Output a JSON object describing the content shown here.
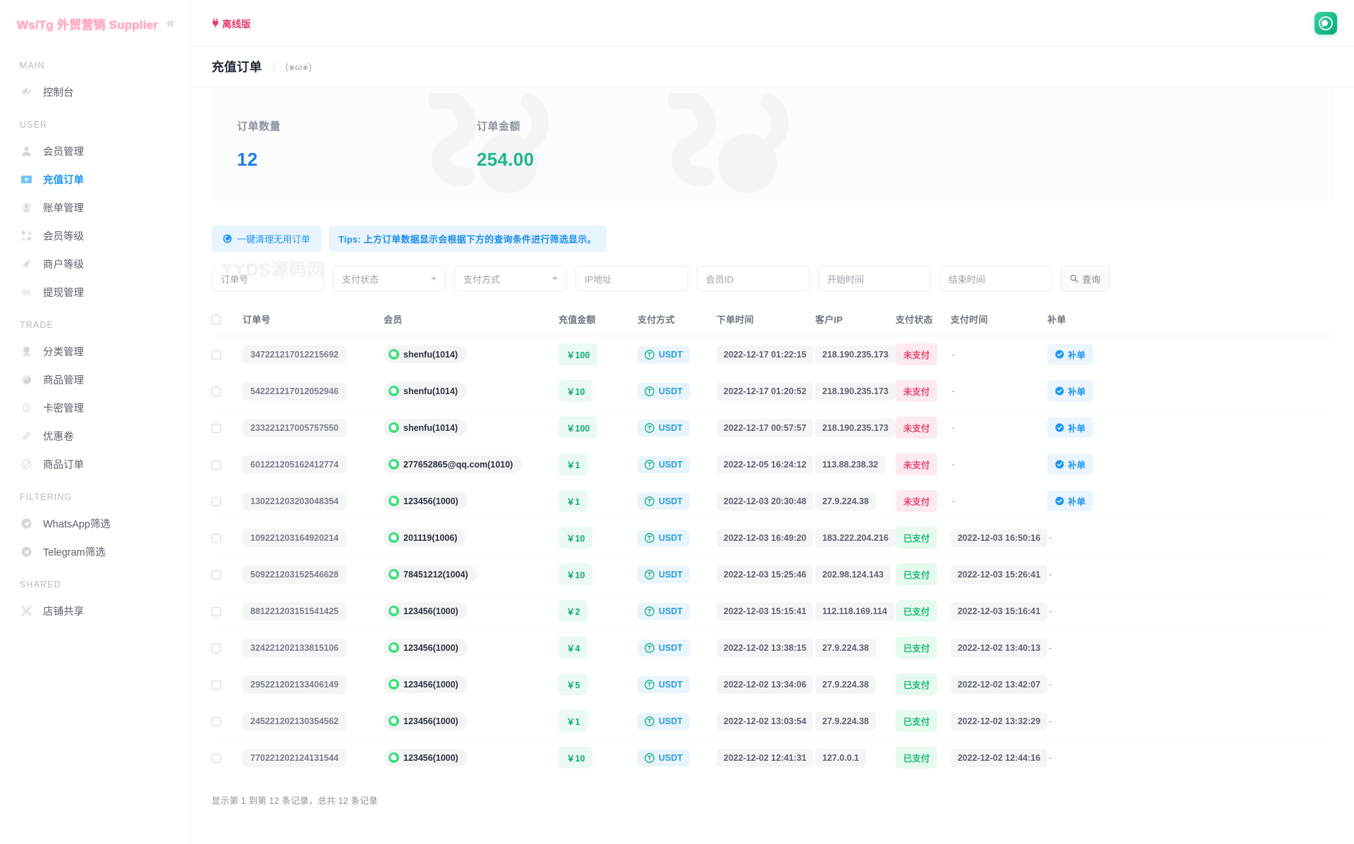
{
  "sidebar": {
    "brand": "Ws/Tg 外贸营销 Supplier",
    "collapse_icon": "chevron-double-left-icon",
    "sections": [
      {
        "label": "MAIN",
        "items": [
          {
            "label": "控制台",
            "icon": "dashboard-icon",
            "active": false
          }
        ]
      },
      {
        "label": "USER",
        "items": [
          {
            "label": "会员管理",
            "icon": "user-icon",
            "active": false
          },
          {
            "label": "充值订单",
            "icon": "recharge-icon",
            "active": true
          },
          {
            "label": "账单管理",
            "icon": "bill-icon",
            "active": false
          },
          {
            "label": "会员等级",
            "icon": "level-icon",
            "active": false
          },
          {
            "label": "商户等级",
            "icon": "merchant-icon",
            "active": false
          },
          {
            "label": "提现管理",
            "icon": "withdraw-icon",
            "active": false
          }
        ]
      },
      {
        "label": "TRADE",
        "items": [
          {
            "label": "分类管理",
            "icon": "category-icon",
            "active": false
          },
          {
            "label": "商品管理",
            "icon": "product-icon",
            "active": false
          },
          {
            "label": "卡密管理",
            "icon": "card-icon",
            "active": false
          },
          {
            "label": "优惠卷",
            "icon": "coupon-icon",
            "active": false
          },
          {
            "label": "商品订单",
            "icon": "order-icon",
            "active": false
          }
        ]
      },
      {
        "label": "FILTERING",
        "items": [
          {
            "label": "WhatsApp筛选",
            "icon": "telegram-icon",
            "active": false
          },
          {
            "label": "Telegram筛选",
            "icon": "telegram-icon",
            "active": false
          }
        ]
      },
      {
        "label": "SHARED",
        "items": [
          {
            "label": "店铺共享",
            "icon": "share-icon",
            "active": false
          }
        ]
      }
    ]
  },
  "topbar": {
    "offline_label": "离线版",
    "offline_icon": "plug-icon",
    "avatar_icon": "avatar-icon"
  },
  "page": {
    "title": "充值订单",
    "subtitle": "(๑ω๑)"
  },
  "stats": [
    {
      "label": "订单数量",
      "value": "12",
      "color": "#1f7fe0"
    },
    {
      "label": "订单金额",
      "value": "254.00",
      "color": "#1db887"
    }
  ],
  "toolbar": {
    "clean_label": "一键清理无用订单",
    "clean_icon": "clean-icon",
    "tips": "Tips: 上方订单数据显示会根据下方的查询条件进行筛选显示。"
  },
  "watermark": "YYDS源码网",
  "filters": {
    "order_no_placeholder": "订单号",
    "pay_status_placeholder": "支付状态",
    "pay_method_placeholder": "支付方式",
    "ip_placeholder": "IP地址",
    "member_id_placeholder": "会员ID",
    "start_time_placeholder": "开始时间",
    "end_time_placeholder": "结束时间",
    "search_label": "查询",
    "search_icon": "search-icon"
  },
  "table": {
    "headers": [
      "",
      "订单号",
      "会员",
      "充值金额",
      "支付方式",
      "下单时间",
      "客户IP",
      "支付状态",
      "支付时间",
      "补单"
    ],
    "supplement_label": "补单",
    "rows": [
      {
        "order_no": "347221217012215692",
        "member": "shenfu(1014)",
        "amount": "￥100",
        "method": "USDT",
        "order_time": "2022-12-17 01:22:15",
        "ip": "218.190.235.173",
        "status": "未支付",
        "paid": false,
        "pay_time": "-",
        "supplement": true
      },
      {
        "order_no": "542221217012052946",
        "member": "shenfu(1014)",
        "amount": "￥10",
        "method": "USDT",
        "order_time": "2022-12-17 01:20:52",
        "ip": "218.190.235.173",
        "status": "未支付",
        "paid": false,
        "pay_time": "-",
        "supplement": true
      },
      {
        "order_no": "233221217005757550",
        "member": "shenfu(1014)",
        "amount": "￥100",
        "method": "USDT",
        "order_time": "2022-12-17 00:57:57",
        "ip": "218.190.235.173",
        "status": "未支付",
        "paid": false,
        "pay_time": "-",
        "supplement": true
      },
      {
        "order_no": "601221205162412774",
        "member": "277652865@qq.com(1010)",
        "amount": "￥1",
        "method": "USDT",
        "order_time": "2022-12-05 16:24:12",
        "ip": "113.88.238.32",
        "status": "未支付",
        "paid": false,
        "pay_time": "-",
        "supplement": true
      },
      {
        "order_no": "130221203203048354",
        "member": "123456(1000)",
        "amount": "￥1",
        "method": "USDT",
        "order_time": "2022-12-03 20:30:48",
        "ip": "27.9.224.38",
        "status": "未支付",
        "paid": false,
        "pay_time": "-",
        "supplement": true
      },
      {
        "order_no": "109221203164920214",
        "member": "201119(1006)",
        "amount": "￥10",
        "method": "USDT",
        "order_time": "2022-12-03 16:49:20",
        "ip": "183.222.204.216",
        "status": "已支付",
        "paid": true,
        "pay_time": "2022-12-03 16:50:16",
        "supplement": false
      },
      {
        "order_no": "509221203152546628",
        "member": "78451212(1004)",
        "amount": "￥10",
        "method": "USDT",
        "order_time": "2022-12-03 15:25:46",
        "ip": "202.98.124.143",
        "status": "已支付",
        "paid": true,
        "pay_time": "2022-12-03 15:26:41",
        "supplement": false
      },
      {
        "order_no": "881221203151541425",
        "member": "123456(1000)",
        "amount": "￥2",
        "method": "USDT",
        "order_time": "2022-12-03 15:15:41",
        "ip": "112.118.169.114",
        "status": "已支付",
        "paid": true,
        "pay_time": "2022-12-03 15:16:41",
        "supplement": false
      },
      {
        "order_no": "324221202133815106",
        "member": "123456(1000)",
        "amount": "￥4",
        "method": "USDT",
        "order_time": "2022-12-02 13:38:15",
        "ip": "27.9.224.38",
        "status": "已支付",
        "paid": true,
        "pay_time": "2022-12-02 13:40:13",
        "supplement": false
      },
      {
        "order_no": "295221202133406149",
        "member": "123456(1000)",
        "amount": "￥5",
        "method": "USDT",
        "order_time": "2022-12-02 13:34:06",
        "ip": "27.9.224.38",
        "status": "已支付",
        "paid": true,
        "pay_time": "2022-12-02 13:42:07",
        "supplement": false
      },
      {
        "order_no": "245221202130354562",
        "member": "123456(1000)",
        "amount": "￥1",
        "method": "USDT",
        "order_time": "2022-12-02 13:03:54",
        "ip": "27.9.224.38",
        "status": "已支付",
        "paid": true,
        "pay_time": "2022-12-02 13:32:29",
        "supplement": false
      },
      {
        "order_no": "770221202124131544",
        "member": "123456(1000)",
        "amount": "￥10",
        "method": "USDT",
        "order_time": "2022-12-02 12:41:31",
        "ip": "127.0.0.1",
        "status": "已支付",
        "paid": true,
        "pay_time": "2022-12-02 12:44:16",
        "supplement": false
      }
    ],
    "footer": "显示第 1 到第 12 条记录，总共 12 条记录"
  }
}
